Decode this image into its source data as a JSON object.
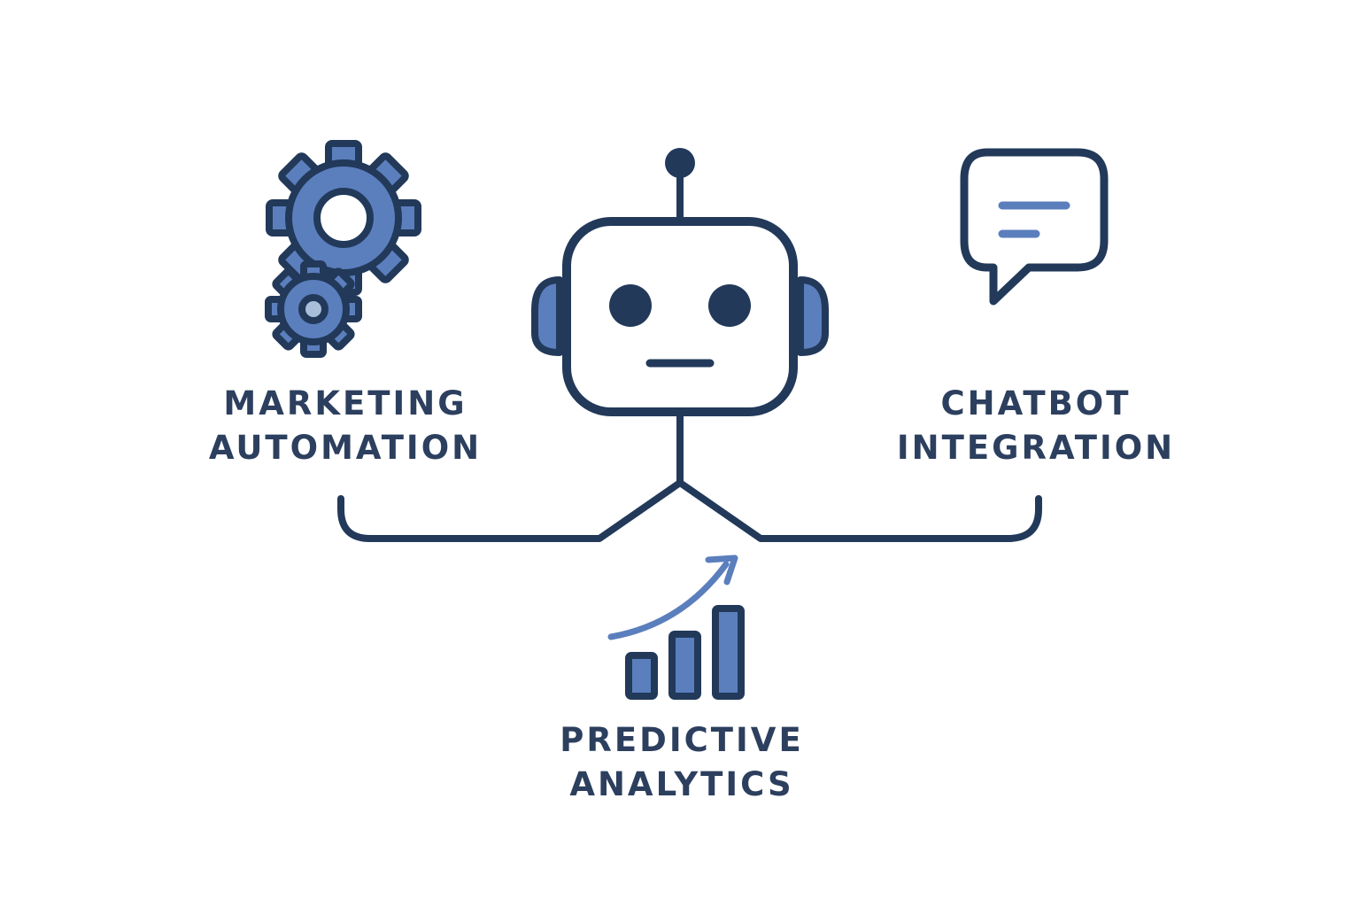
{
  "colors": {
    "stroke": "#22395a",
    "accent": "#5b7fbd",
    "text": "#2c3f5e",
    "background": "#ffffff"
  },
  "center": {
    "icon": "robot-icon"
  },
  "nodes": [
    {
      "icon": "gears-icon",
      "label_line1": "MARKETING",
      "label_line2": "AUTOMATION"
    },
    {
      "icon": "chat-bubble-icon",
      "label_line1": "CHATBOT",
      "label_line2": "INTEGRATION"
    },
    {
      "icon": "bar-chart-growth-icon",
      "label_line1": "PREDICTIVE",
      "label_line2": "ANALYTICS"
    }
  ]
}
